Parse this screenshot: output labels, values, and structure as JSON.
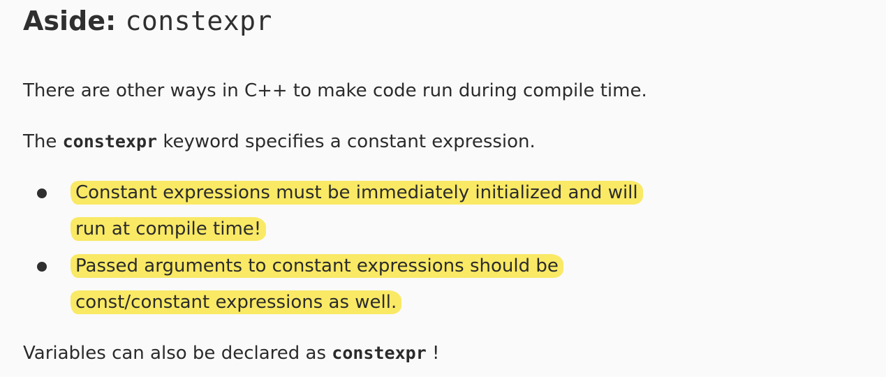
{
  "heading": {
    "prefix": "Aside: ",
    "code": "constexpr"
  },
  "paragraphs": {
    "p1": "There are other ways in C++ to make code run during compile time.",
    "p2_before": "The ",
    "p2_code": "constexpr",
    "p2_after": " keyword specifies a constant expression.",
    "p3_before": "Variables can also be declared as ",
    "p3_code": "constexpr",
    "p3_after": " !"
  },
  "bullets": [
    {
      "lines": [
        "Constant expressions must be immediately initialized and will",
        "run at compile time!"
      ]
    },
    {
      "lines": [
        "Passed arguments to constant expressions should be",
        "const/constant expressions as well."
      ]
    }
  ],
  "colors": {
    "highlight": "#f9e965",
    "background": "#fafafa",
    "text": "#2b2b2b"
  }
}
